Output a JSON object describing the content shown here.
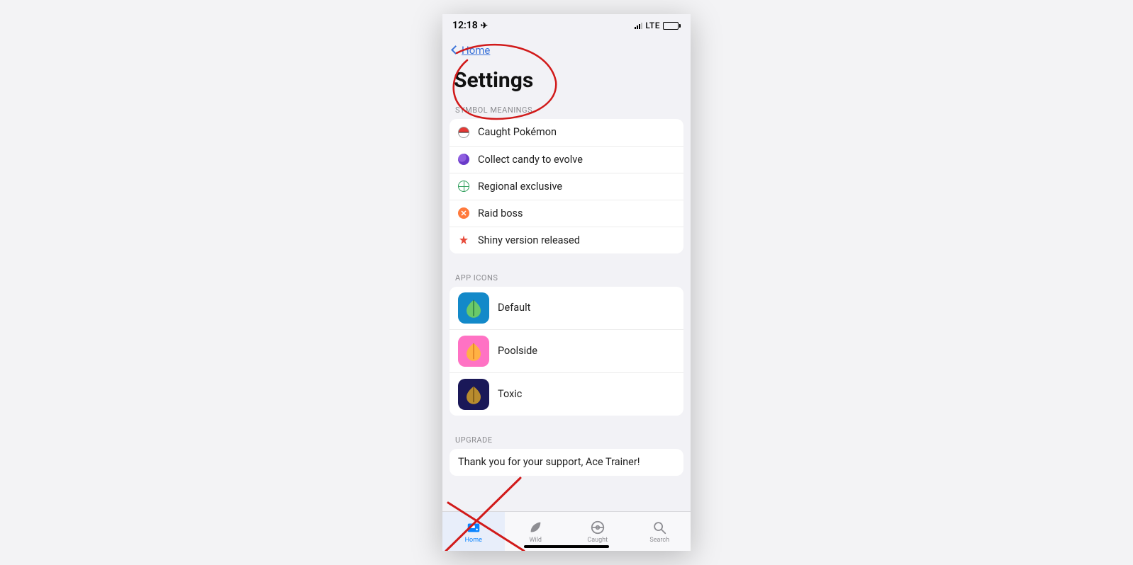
{
  "status": {
    "time": "12:18",
    "network": "LTE"
  },
  "nav": {
    "back_label": "Home"
  },
  "title": "Settings",
  "sections": {
    "symbol_meanings_header": "SYMBOL MEANINGS",
    "app_icons_header": "APP ICONS",
    "upgrade_header": "UPGRADE"
  },
  "symbols": [
    {
      "icon": "pokeball",
      "label": "Caught Pokémon"
    },
    {
      "icon": "candy",
      "label": "Collect candy to evolve"
    },
    {
      "icon": "globe",
      "label": "Regional exclusive"
    },
    {
      "icon": "raid",
      "label": "Raid boss"
    },
    {
      "icon": "shiny",
      "label": "Shiny version released"
    }
  ],
  "app_icons": [
    {
      "theme": "default",
      "label": "Default"
    },
    {
      "theme": "poolside",
      "label": "Poolside"
    },
    {
      "theme": "toxic",
      "label": "Toxic"
    }
  ],
  "upgrade": {
    "message": "Thank you for your support, Ace Trainer!"
  },
  "tabs": [
    {
      "key": "home",
      "label": "Home",
      "active": true
    },
    {
      "key": "wild",
      "label": "Wild",
      "active": false
    },
    {
      "key": "caught",
      "label": "Caught",
      "active": false
    },
    {
      "key": "search",
      "label": "Search",
      "active": false
    }
  ]
}
